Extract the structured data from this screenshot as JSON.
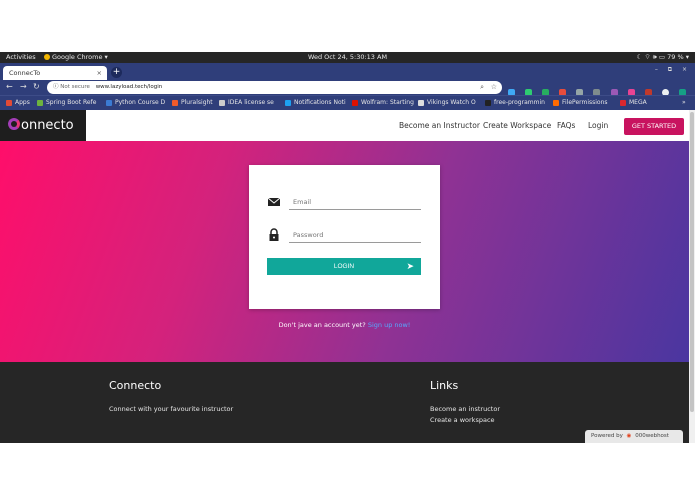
{
  "os": {
    "activities": "Activities",
    "app": "Google Chrome ▾",
    "clock": "Wed Oct 24,  5:30:13 AM",
    "battery": "79 %"
  },
  "browser": {
    "tab_title": "ConnecTo",
    "tab_close": "×",
    "new_tab": "+",
    "not_secure": "Not secure",
    "url": "www.lazyload.tech/login",
    "window_controls": "– ⧉ ×"
  },
  "bookmarks": [
    {
      "label": "Apps",
      "color": "#e24a36"
    },
    {
      "label": "Spring Boot Refe",
      "color": "#6db33f"
    },
    {
      "label": "Python Course D",
      "color": "#3b7bd4"
    },
    {
      "label": "Pluralsight",
      "color": "#f15b2a"
    },
    {
      "label": "IDEA license se",
      "color": "#cccccc"
    },
    {
      "label": "Notifications Noti",
      "color": "#1da1f2"
    },
    {
      "label": "Wolfram: Starting",
      "color": "#dd1100"
    },
    {
      "label": "Vikings Watch O",
      "color": "#dddddd"
    },
    {
      "label": "free-programmin",
      "color": "#222222"
    },
    {
      "label": "FilePermissions",
      "color": "#ff6a00"
    },
    {
      "label": "MEGA",
      "color": "#d9272e"
    },
    {
      "label": "»",
      "color": ""
    }
  ],
  "site": {
    "logo_text": "onnecto",
    "nav": {
      "instructor": "Become an Instructor",
      "workspace": "Create Workspace",
      "faqs": "FAQs",
      "login": "Login",
      "get_started": "GET STARTED"
    }
  },
  "login": {
    "email_placeholder": "Email",
    "password_placeholder": "Password",
    "button_label": "LOGIN",
    "signup_prompt": "Don't jave an account yet?",
    "signup_link": "Sign up now!"
  },
  "footer": {
    "brand_title": "Connecto",
    "tagline": "Connect with your favourite instructor",
    "links_title": "Links",
    "link_instructor": "Become an instructor",
    "link_workspace": "Create a workspace",
    "powered_by": "Powered by",
    "powered_brand": "000webhost"
  },
  "colors": {
    "accent_button": "#c8135f",
    "login_button": "#11a79a",
    "gradient_start": "#ff0e6a",
    "gradient_end": "#4a36a0",
    "footer_bg": "#262626",
    "signup_link": "#57a8ff"
  }
}
